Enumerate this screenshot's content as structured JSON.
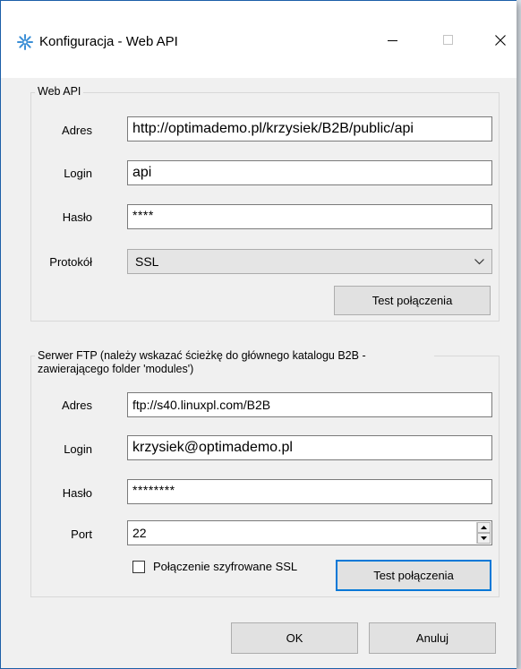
{
  "window": {
    "title": "Konfiguracja - Web API",
    "icon": "gear-snowflake-icon"
  },
  "webapi": {
    "legend": "Web API",
    "address_label": "Adres",
    "address_value": "http://optimademo.pl/krzysiek/B2B/public/api",
    "login_label": "Login",
    "login_value": "api",
    "password_label": "Hasło",
    "password_value": "****",
    "protocol_label": "Protokół",
    "protocol_value": "SSL",
    "test_button": "Test połączenia"
  },
  "ftp": {
    "legend": "Serwer FTP (należy wskazać ścieżkę do głównego katalogu B2B - zawierającego folder 'modules')",
    "address_label": "Adres",
    "address_value": "ftp://s40.linuxpl.com/B2B",
    "login_label": "Login",
    "login_value": "krzysiek@optimademo.pl",
    "password_label": "Hasło",
    "password_value": "********",
    "port_label": "Port",
    "port_value": "22",
    "ssl_checkbox_label": "Połączenie szyfrowane SSL",
    "ssl_checked": false,
    "test_button": "Test połączenia"
  },
  "footer": {
    "ok_button": "OK",
    "cancel_button": "Anuluj"
  },
  "colors": {
    "window_border": "#1c5fa8",
    "focus_border": "#0078d7",
    "dialog_bg": "#f0f0f0"
  }
}
